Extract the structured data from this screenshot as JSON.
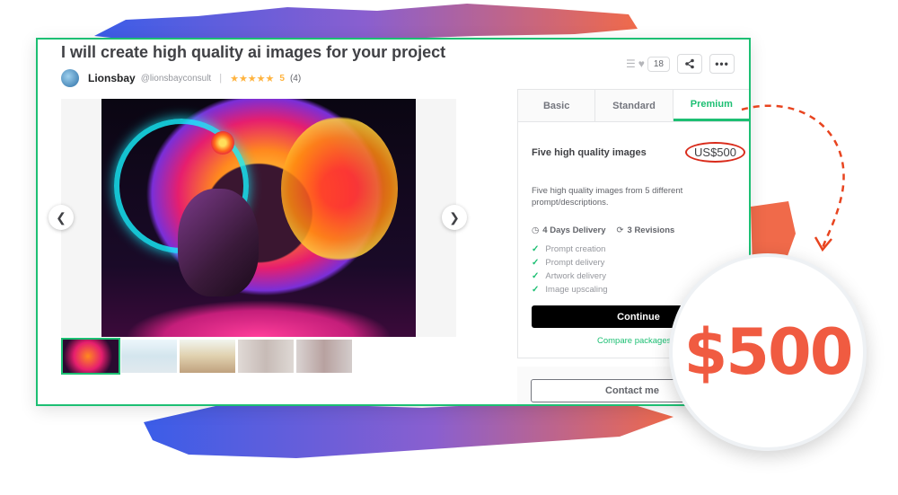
{
  "gig": {
    "title": "I will create high quality ai images for your project",
    "seller_name": "Lionsbay",
    "seller_handle": "@lionsbayconsult",
    "stars": "★★★★★",
    "rating": "5",
    "reviews": "(4)",
    "saves_count": "18"
  },
  "gallery": {
    "prev_icon": "chevron-left-icon",
    "next_icon": "chevron-right-icon",
    "thumbnail_count": 5
  },
  "package": {
    "tabs": [
      "Basic",
      "Standard",
      "Premium"
    ],
    "active_tab": "Premium",
    "name": "Five high quality images",
    "price": "US$500",
    "description": "Five high quality images from 5 different prompt/descriptions.",
    "delivery": "4 Days Delivery",
    "revisions": "3 Revisions",
    "features": [
      "Prompt creation",
      "Prompt delivery",
      "Artwork delivery",
      "Image upscaling"
    ],
    "continue_label": "Continue",
    "compare_label": "Compare packages",
    "contact_label": "Contact me"
  },
  "callout": {
    "price": "$500"
  },
  "colors": {
    "accent": "#1dbf73",
    "highlight": "#d92b1b",
    "callout_text": "#f05b41"
  }
}
